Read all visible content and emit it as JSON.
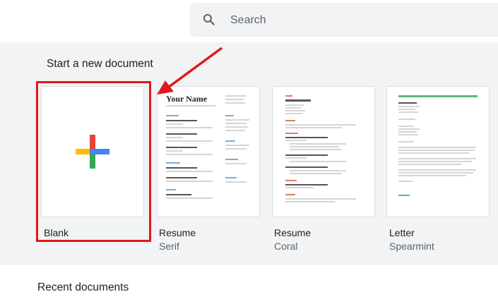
{
  "search": {
    "placeholder": "Search",
    "icon": "search-icon"
  },
  "gallery": {
    "title": "Start a new document",
    "templates": [
      {
        "name": "Blank",
        "subtitle": ""
      },
      {
        "name": "Resume",
        "subtitle": "Serif"
      },
      {
        "name": "Resume",
        "subtitle": "Coral"
      },
      {
        "name": "Letter",
        "subtitle": "Spearmint"
      }
    ],
    "serif_preview_heading": "Your Name"
  },
  "recent": {
    "title": "Recent documents"
  },
  "colors": {
    "plus_red": "#ea4335",
    "plus_blue": "#4285f4",
    "plus_green": "#34a853",
    "plus_yellow": "#fbbc04",
    "highlight": "#e0191b",
    "gallery_bg": "#f1f3f4"
  }
}
